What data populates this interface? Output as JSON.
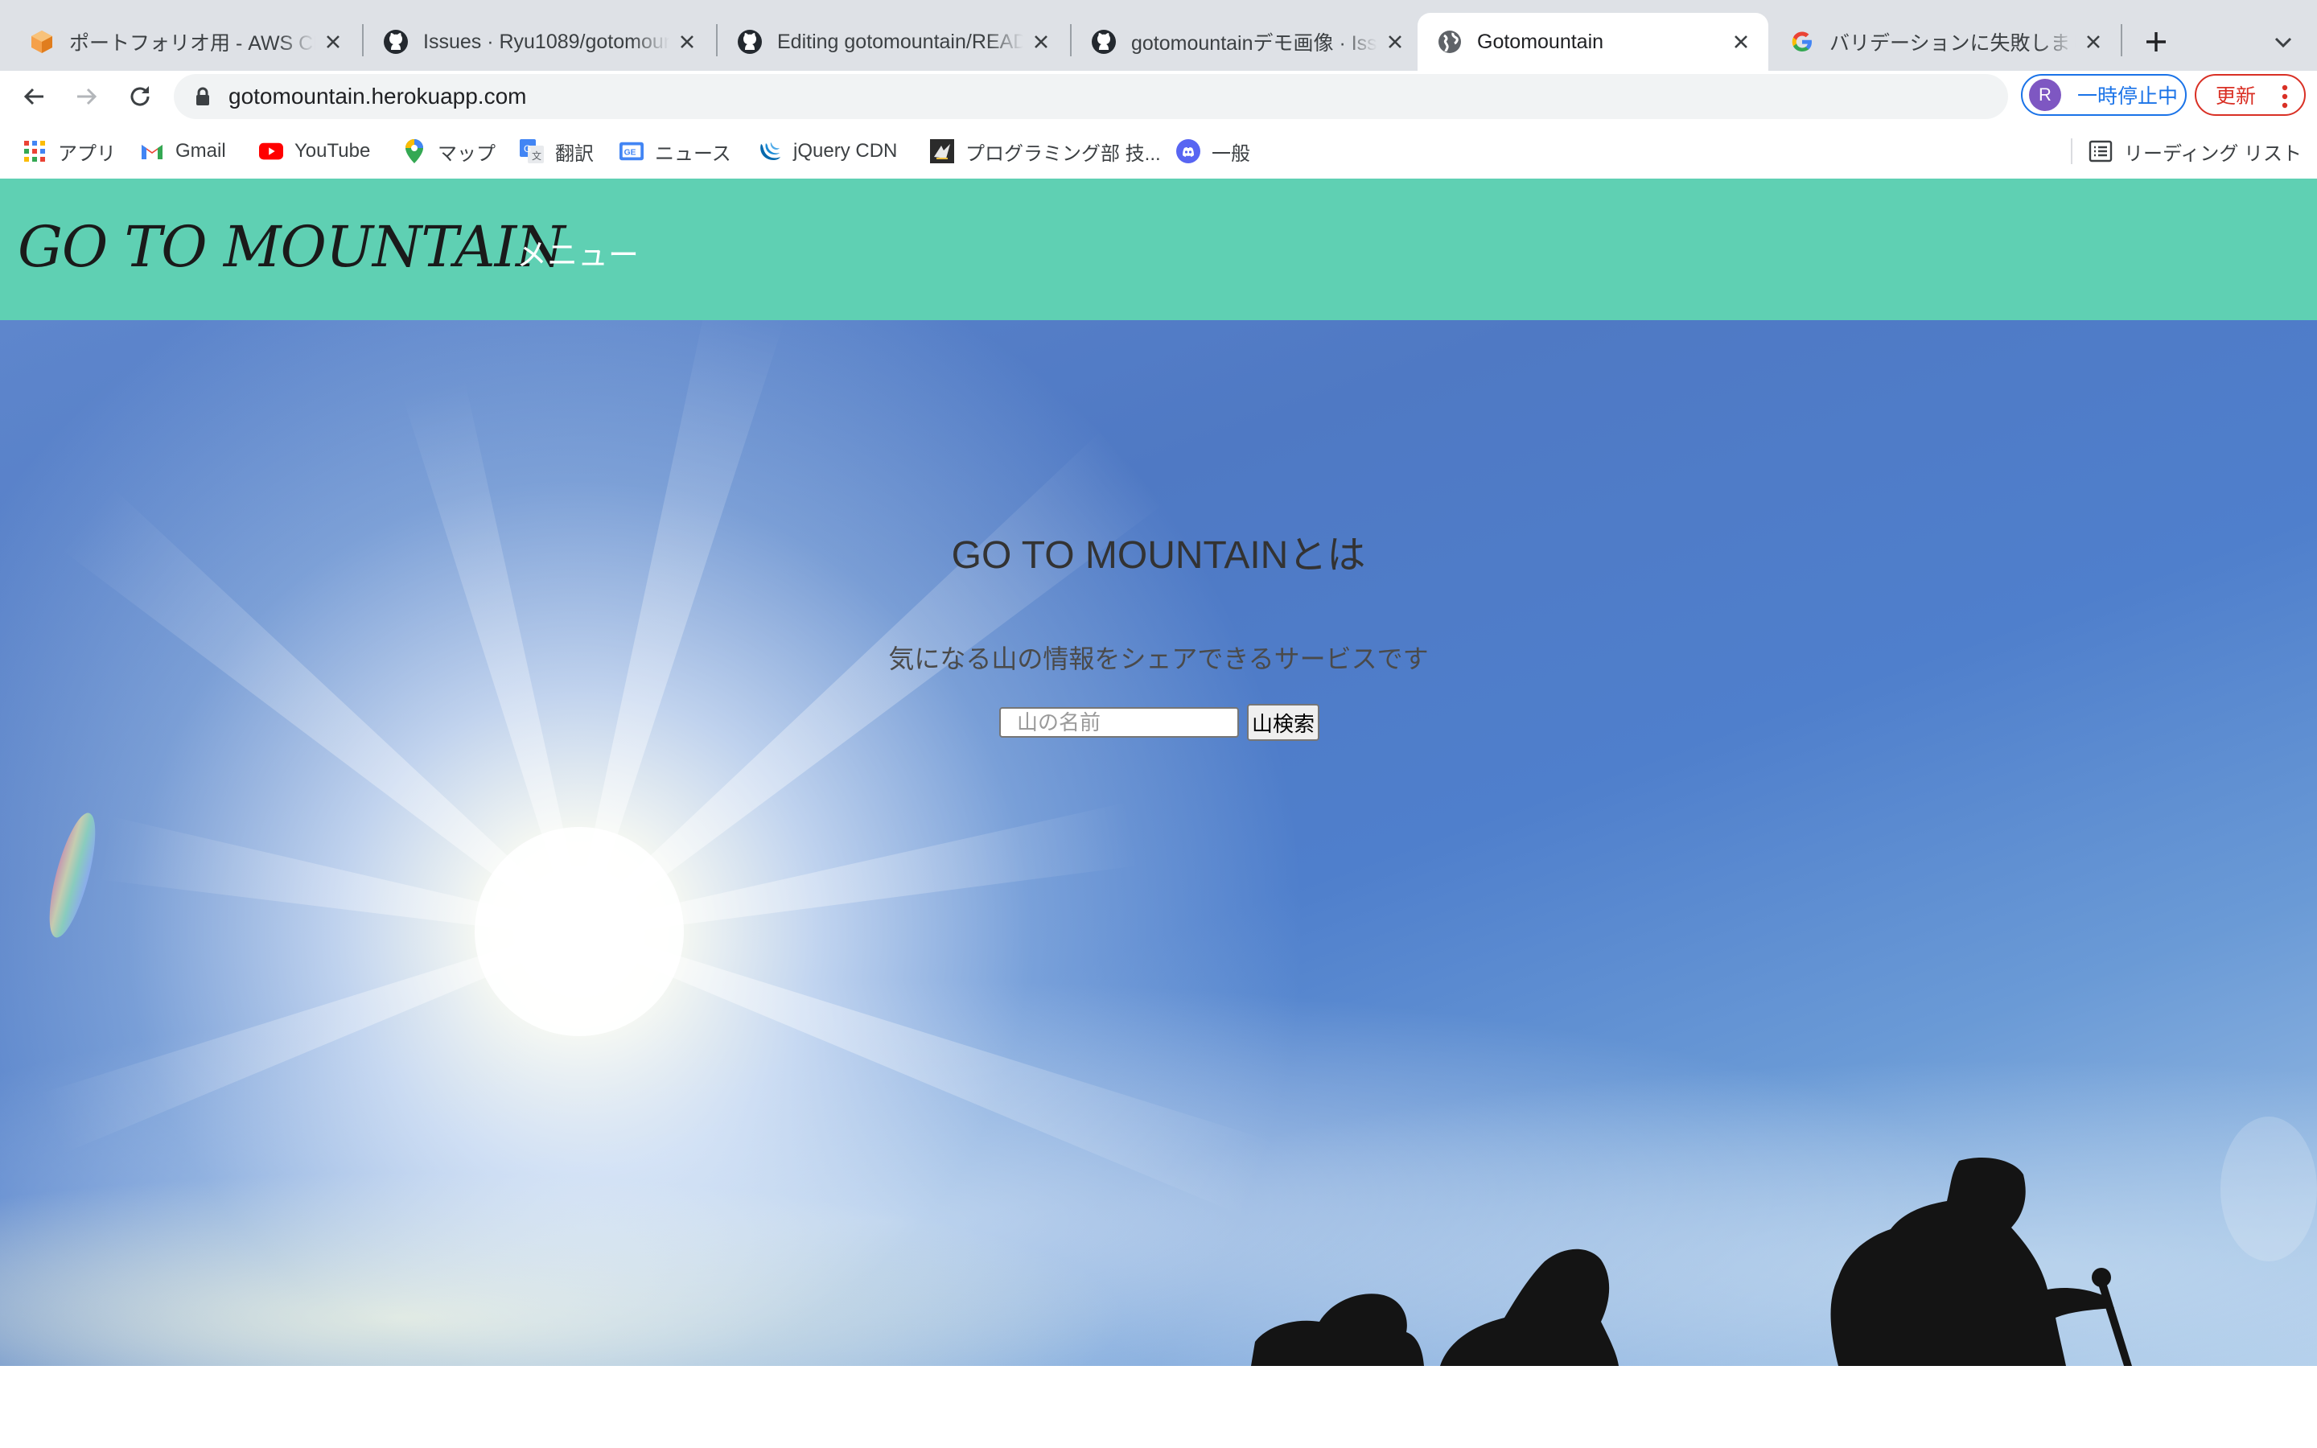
{
  "browser": {
    "tabs": [
      {
        "title": "ポートフォリオ用 - AWS Cloud",
        "favicon": "aws-icon",
        "active": false
      },
      {
        "title": "Issues · Ryu1089/gotomountain",
        "favicon": "github-icon",
        "active": false
      },
      {
        "title": "Editing gotomountain/README",
        "favicon": "github-icon",
        "active": false
      },
      {
        "title": "gotomountainデモ画像 · Issue",
        "favicon": "github-icon",
        "active": false
      },
      {
        "title": "Gotomountain",
        "favicon": "globe-icon",
        "active": true
      },
      {
        "title": "バリデーションに失敗しました",
        "favicon": "google-icon",
        "active": false
      }
    ],
    "url": "gotomountain.herokuapp.com",
    "profile": {
      "initial": "R",
      "label": "一時停止中"
    },
    "update_label": "更新",
    "bookmarks": [
      {
        "label": "アプリ",
        "icon": "apps-grid-icon"
      },
      {
        "label": "Gmail",
        "icon": "gmail-icon"
      },
      {
        "label": "YouTube",
        "icon": "youtube-icon"
      },
      {
        "label": "マップ",
        "icon": "maps-icon"
      },
      {
        "label": "翻訳",
        "icon": "translate-icon"
      },
      {
        "label": "ニュース",
        "icon": "news-icon"
      },
      {
        "label": "jQuery CDN",
        "icon": "jquery-icon"
      },
      {
        "label": "プログラミング部 技...",
        "icon": "club-icon"
      },
      {
        "label": "一般",
        "icon": "discord-icon"
      }
    ],
    "reading_list": "リーディング リスト"
  },
  "site": {
    "logo": "GO TO MOUNTAIN",
    "menu": "メニュー",
    "header_color": "#5fd0b3",
    "hero": {
      "title": "GO TO MOUNTAINとは",
      "subtitle": "気になる山の情報をシェアできるサービスです",
      "search_placeholder": "山の名前",
      "search_button": "山検索"
    }
  }
}
